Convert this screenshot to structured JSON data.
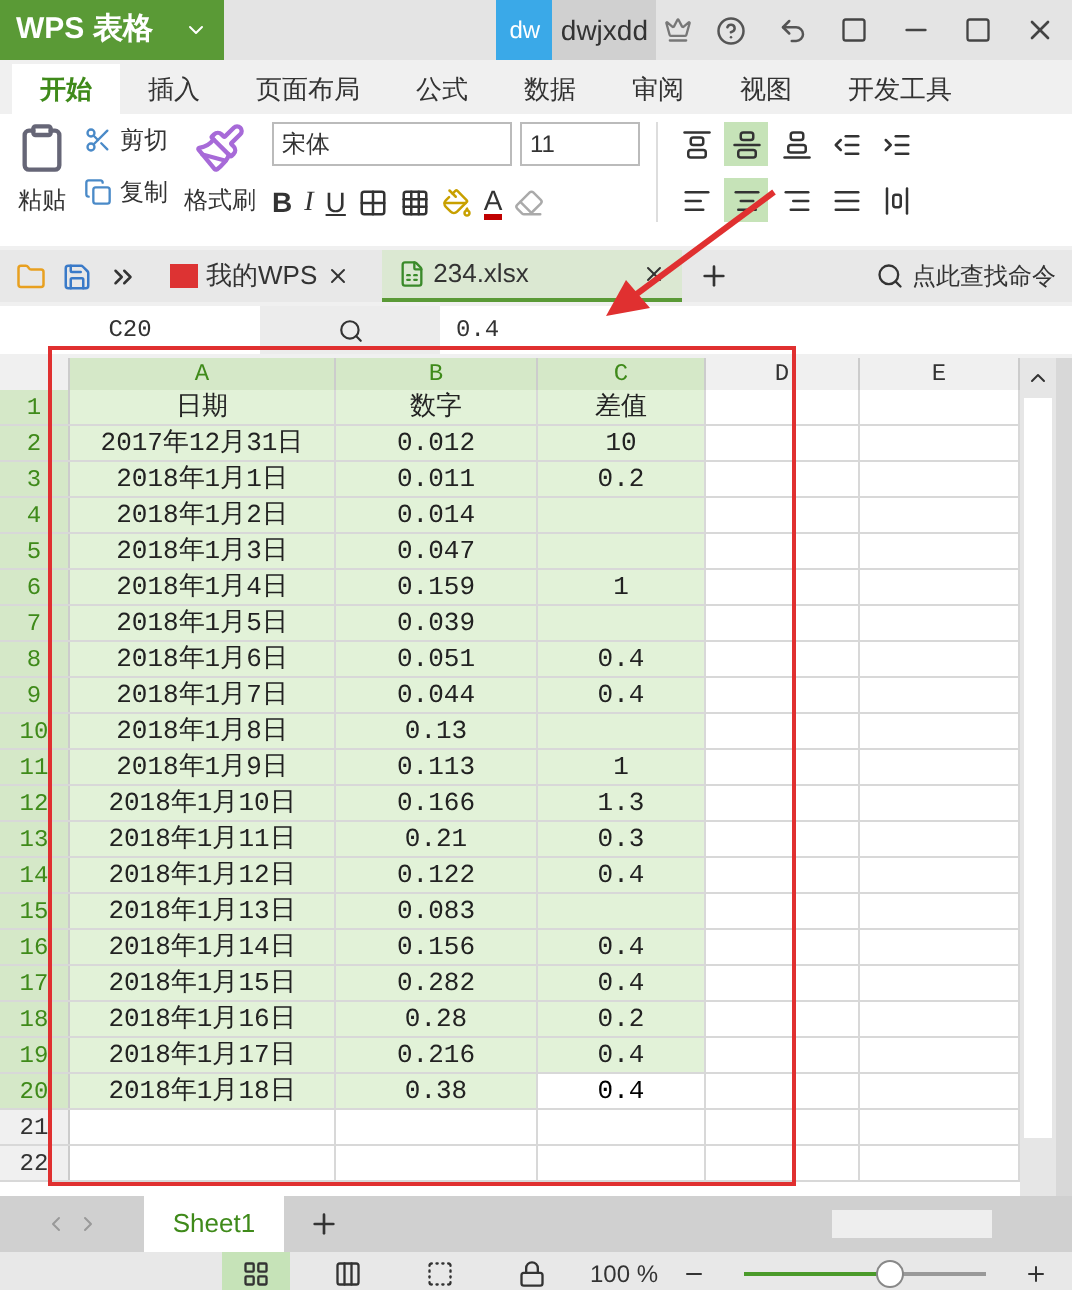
{
  "title_bar": {
    "app_name": "WPS 表格",
    "user_badge": "dw",
    "username": "dwjxdd"
  },
  "ribbon_tabs": [
    {
      "label": "开始",
      "selected": true
    },
    {
      "label": "插入",
      "selected": false
    },
    {
      "label": "页面布局",
      "selected": false
    },
    {
      "label": "公式",
      "selected": false
    },
    {
      "label": "数据",
      "selected": false
    },
    {
      "label": "审阅",
      "selected": false
    },
    {
      "label": "视图",
      "selected": false
    },
    {
      "label": "开发工具",
      "selected": false
    }
  ],
  "clipboard": {
    "paste": "粘贴",
    "cut": "剪切",
    "copy": "复制",
    "format_painter": "格式刷"
  },
  "font": {
    "name": "宋体",
    "size": "11",
    "bold": "B",
    "italic": "I",
    "underline": "U",
    "font_color": "A"
  },
  "align_top_row": [
    {
      "kind": "top",
      "selected": false
    },
    {
      "kind": "middle",
      "selected": true
    },
    {
      "kind": "bottom",
      "selected": false
    },
    {
      "kind": "outdent",
      "selected": false
    },
    {
      "kind": "indent",
      "selected": false
    }
  ],
  "align_bottom_row": [
    {
      "kind": "left",
      "selected": false
    },
    {
      "kind": "center",
      "selected": true
    },
    {
      "kind": "right",
      "selected": false
    },
    {
      "kind": "justify",
      "selected": false
    },
    {
      "kind": "distributed",
      "selected": false
    }
  ],
  "doc_tabs": [
    {
      "label": "我的WPS",
      "kind": "home",
      "selected": false
    },
    {
      "label": "234.xlsx",
      "kind": "sheet",
      "selected": true
    }
  ],
  "command_search": "点此查找命令",
  "formula_bar": {
    "cell_ref": "C20",
    "value": "0.4"
  },
  "columns": [
    {
      "label": "A",
      "selected": true
    },
    {
      "label": "B",
      "selected": true
    },
    {
      "label": "C",
      "selected": true
    },
    {
      "label": "D",
      "selected": false
    },
    {
      "label": "E",
      "selected": false
    }
  ],
  "rows": [
    {
      "number": "1",
      "selected": true,
      "cells": [
        {
          "text": "日期",
          "active": false
        },
        {
          "text": "数字",
          "active": false
        },
        {
          "text": "差值",
          "active": false
        }
      ]
    },
    {
      "number": "2",
      "selected": true,
      "cells": [
        {
          "text": "2017年12月31日",
          "active": false
        },
        {
          "text": "0.012",
          "active": false
        },
        {
          "text": "10",
          "active": false
        }
      ]
    },
    {
      "number": "3",
      "selected": true,
      "cells": [
        {
          "text": "2018年1月1日",
          "active": false
        },
        {
          "text": "0.011",
          "active": false
        },
        {
          "text": "0.2",
          "active": false
        }
      ]
    },
    {
      "number": "4",
      "selected": true,
      "cells": [
        {
          "text": "2018年1月2日",
          "active": false
        },
        {
          "text": "0.014",
          "active": false
        },
        {
          "active": false
        }
      ]
    },
    {
      "number": "5",
      "selected": true,
      "cells": [
        {
          "text": "2018年1月3日",
          "active": false
        },
        {
          "text": "0.047",
          "active": false
        },
        {
          "active": false
        }
      ]
    },
    {
      "number": "6",
      "selected": true,
      "cells": [
        {
          "text": "2018年1月4日",
          "active": false
        },
        {
          "text": "0.159",
          "active": false
        },
        {
          "text": "1",
          "active": false
        }
      ]
    },
    {
      "number": "7",
      "selected": true,
      "cells": [
        {
          "text": "2018年1月5日",
          "active": false
        },
        {
          "text": "0.039",
          "active": false
        },
        {
          "active": false
        }
      ]
    },
    {
      "number": "8",
      "selected": true,
      "cells": [
        {
          "text": "2018年1月6日",
          "active": false
        },
        {
          "text": "0.051",
          "active": false
        },
        {
          "text": "0.4",
          "active": false
        }
      ]
    },
    {
      "number": "9",
      "selected": true,
      "cells": [
        {
          "text": "2018年1月7日",
          "active": false
        },
        {
          "text": "0.044",
          "active": false
        },
        {
          "text": "0.4",
          "active": false
        }
      ]
    },
    {
      "number": "10",
      "selected": true,
      "cells": [
        {
          "text": "2018年1月8日",
          "active": false
        },
        {
          "text": "0.13",
          "active": false
        },
        {
          "active": false
        }
      ]
    },
    {
      "number": "11",
      "selected": true,
      "cells": [
        {
          "text": "2018年1月9日",
          "active": false
        },
        {
          "text": "0.113",
          "active": false
        },
        {
          "text": "1",
          "active": false
        }
      ]
    },
    {
      "number": "12",
      "selected": true,
      "cells": [
        {
          "text": "2018年1月10日",
          "active": false
        },
        {
          "text": "0.166",
          "active": false
        },
        {
          "text": "1.3",
          "active": false
        }
      ]
    },
    {
      "number": "13",
      "selected": true,
      "cells": [
        {
          "text": "2018年1月11日",
          "active": false
        },
        {
          "text": "0.21",
          "active": false
        },
        {
          "text": "0.3",
          "active": false
        }
      ]
    },
    {
      "number": "14",
      "selected": true,
      "cells": [
        {
          "text": "2018年1月12日",
          "active": false
        },
        {
          "text": "0.122",
          "active": false
        },
        {
          "text": "0.4",
          "active": false
        }
      ]
    },
    {
      "number": "15",
      "selected": true,
      "cells": [
        {
          "text": "2018年1月13日",
          "active": false
        },
        {
          "text": "0.083",
          "active": false
        },
        {
          "active": false
        }
      ]
    },
    {
      "number": "16",
      "selected": true,
      "cells": [
        {
          "text": "2018年1月14日",
          "active": false
        },
        {
          "text": "0.156",
          "active": false
        },
        {
          "text": "0.4",
          "active": false
        }
      ]
    },
    {
      "number": "17",
      "selected": true,
      "cells": [
        {
          "text": "2018年1月15日",
          "active": false
        },
        {
          "text": "0.282",
          "active": false
        },
        {
          "text": "0.4",
          "active": false
        }
      ]
    },
    {
      "number": "18",
      "selected": true,
      "cells": [
        {
          "text": "2018年1月16日",
          "active": false
        },
        {
          "text": "0.28",
          "active": false
        },
        {
          "text": "0.2",
          "active": false
        }
      ]
    },
    {
      "number": "19",
      "selected": true,
      "cells": [
        {
          "text": "2018年1月17日",
          "active": false
        },
        {
          "text": "0.216",
          "active": false
        },
        {
          "text": "0.4",
          "active": false
        }
      ]
    },
    {
      "number": "20",
      "selected": true,
      "cells": [
        {
          "text": "2018年1月18日",
          "active": false
        },
        {
          "text": "0.38",
          "active": false
        },
        {
          "text": "0.4",
          "active": true
        }
      ]
    },
    {
      "number": "21",
      "selected": false,
      "cells": []
    },
    {
      "number": "22",
      "selected": false,
      "cells": []
    }
  ],
  "sheet_tabs": [
    {
      "label": "Sheet1",
      "selected": true
    }
  ],
  "status_bar": {
    "views": [
      {
        "kind": "normal",
        "selected": true
      },
      {
        "kind": "page_break",
        "selected": false
      },
      {
        "kind": "freeze",
        "selected": false
      },
      {
        "kind": "protect",
        "selected": false
      }
    ],
    "zoom": "100 %",
    "zoom_slider": {
      "level": 0.6
    }
  }
}
